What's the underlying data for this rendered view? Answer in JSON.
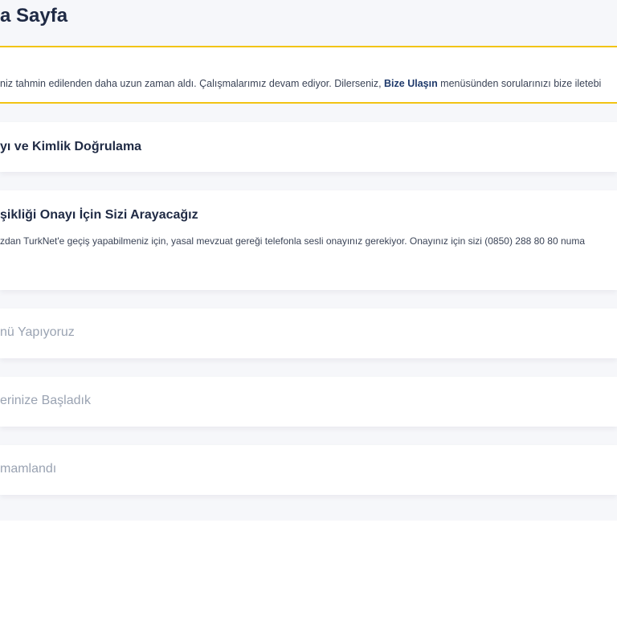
{
  "page": {
    "title": "a Sayfa"
  },
  "notice": {
    "text_before": "niz tahmin edilenden daha uzun zaman aldı. Çalışmalarımız devam ediyor. Dilerseniz, ",
    "link_label": "Bize Ulaşın",
    "text_after": " menüsünden sorularınızı bize iletebi"
  },
  "steps": [
    {
      "title": "yı ve Kimlik Doğrulama"
    },
    {
      "title": "şikliği Onayı İçin Sizi Arayacağız",
      "description": "zdan TurkNet'e geçiş yapabilmeniz için, yasal mevzuat gereği telefonla sesli onayınız gerekiyor. Onayınız için sizi (0850) 288 80 80 numa"
    },
    {
      "title": "nü Yapıyoruz"
    },
    {
      "title": "erinize Başladık"
    },
    {
      "title": "mamlandı"
    }
  ],
  "colors": {
    "accent": "#f2c414",
    "heading": "#1f2a44",
    "link": "#1f3a6b",
    "muted": "#9aa3b2",
    "background": "#f6f7fa"
  }
}
